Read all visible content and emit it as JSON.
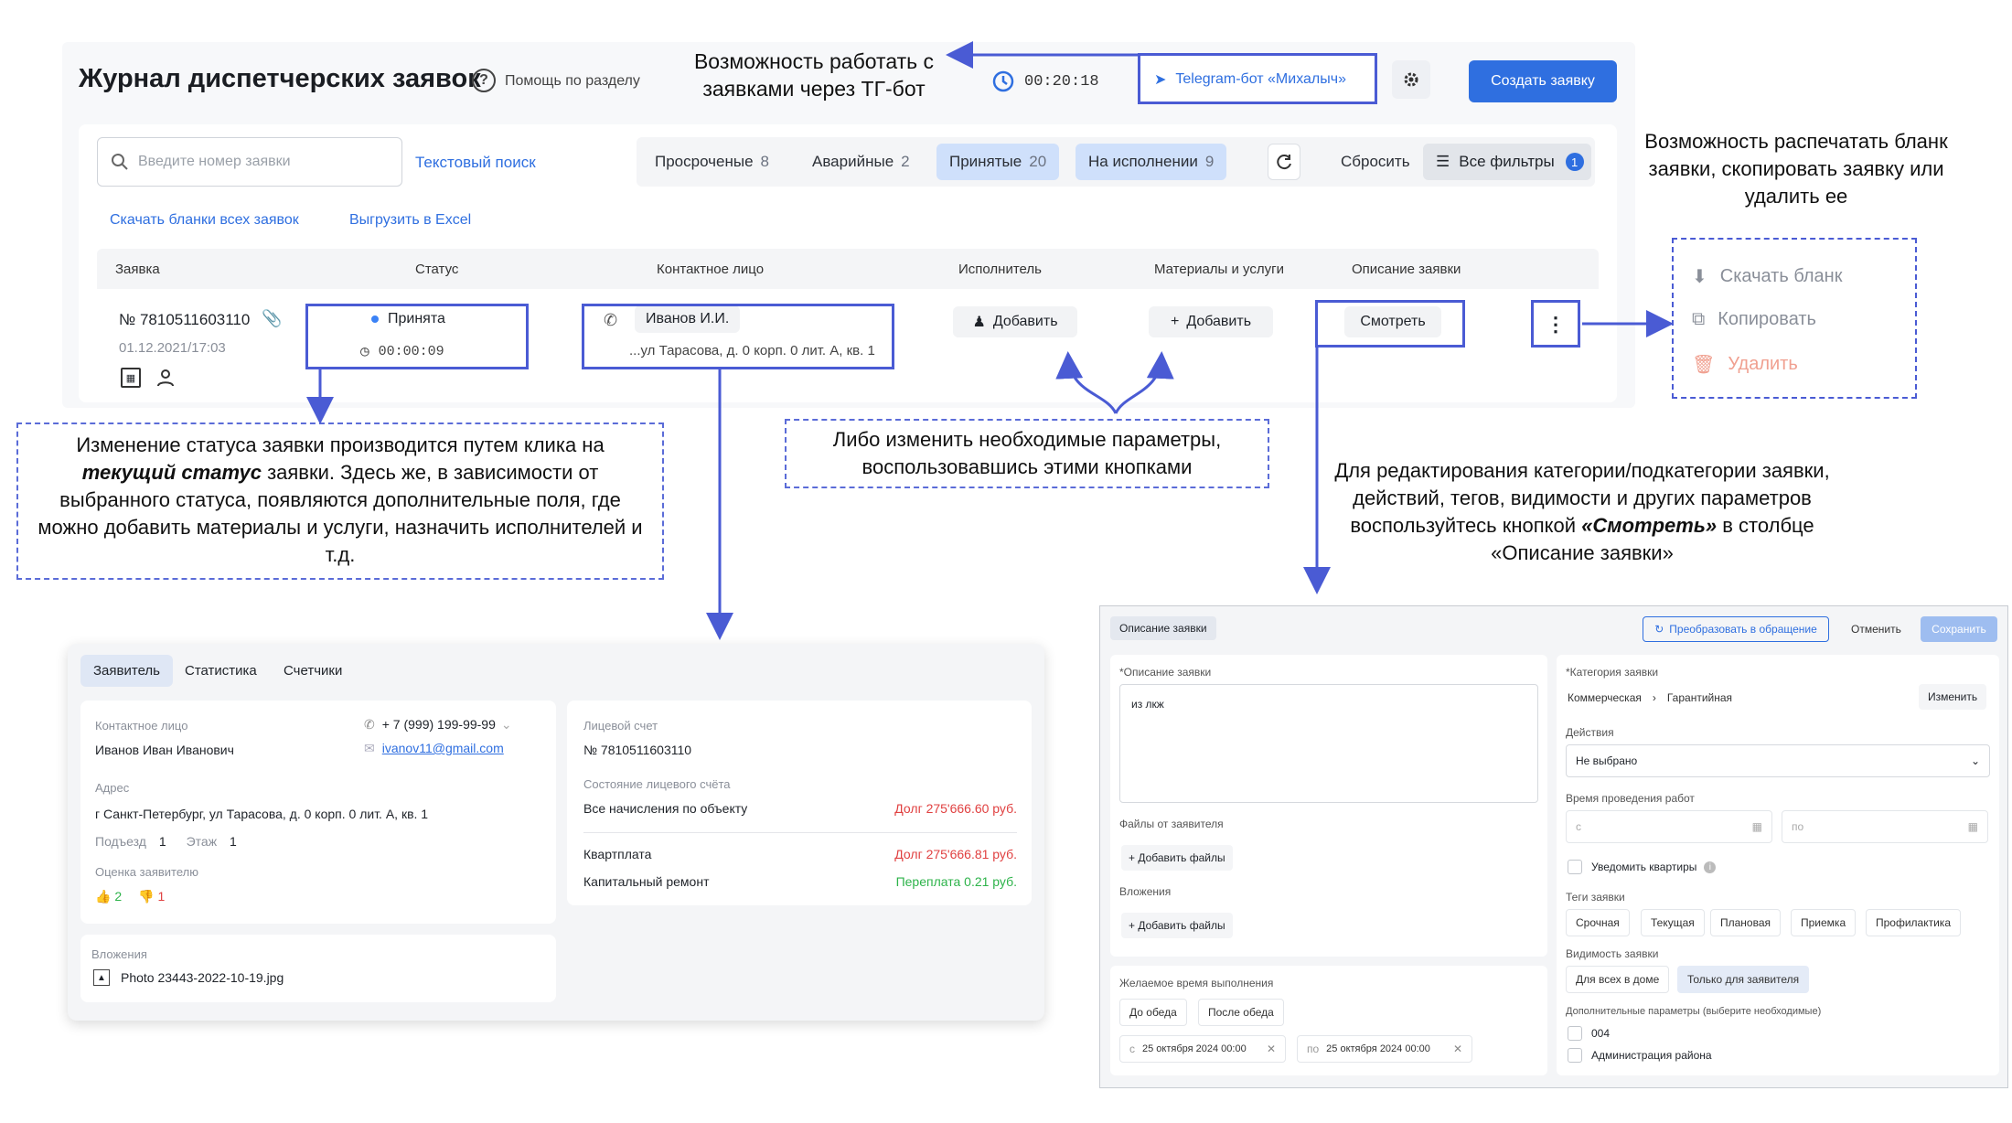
{
  "header": {
    "title": "Журнал диспетчерских заявок",
    "help": "Помощь по разделу",
    "timer": "00:20:18",
    "telegram": "Telegram-бот «Михалыч»",
    "create": "Создать заявку"
  },
  "search": {
    "placeholder": "Введите номер заявки",
    "text_search": "Текстовый поиск"
  },
  "filters": [
    {
      "label": "Просроченые",
      "count": "8"
    },
    {
      "label": "Аварийные",
      "count": "2"
    },
    {
      "label": "Принятые",
      "count": "20"
    },
    {
      "label": "На исполнении",
      "count": "9"
    }
  ],
  "reset": "Сбросить",
  "all_filters": "Все фильтры",
  "all_filters_count": "1",
  "links": {
    "download": "Скачать бланки всех заявок",
    "excel": "Выгрузить в Excel"
  },
  "table": {
    "columns": [
      "Заявка",
      "Статус",
      "Контактное лицо",
      "Исполнитель",
      "Материалы и услуги",
      "Описание заявки"
    ],
    "row": {
      "number": "№ 7810511603110",
      "date": "01.12.2021/17:03",
      "status": "Принята",
      "status_timer": "00:00:09",
      "contact": "Иванов И.И.",
      "address": "...ул Тарасова, д. 0 корп. 0 лит. А, кв. 1",
      "executor_add": "Добавить",
      "materials_add": "Добавить",
      "view": "Смотреть"
    }
  },
  "menu": {
    "download": "Скачать бланк",
    "copy": "Копировать",
    "delete": "Удалить"
  },
  "notes": {
    "tg": "Возможность работать с заявками через ТГ-бот",
    "print": "Возможность распечатать бланк заявки, скопировать заявку или удалить ее",
    "status_a": "Изменение статуса заявки производится путем клика на ",
    "status_b": "текущий статус",
    "status_c": " заявки. Здесь же, в зависимости от выбранного статуса, появляются дополнительные поля, где можно добавить материалы и услуги, назначить исполнителей и т.д.",
    "params": "Либо изменить необходимые параметры, воспользовавшись этими кнопками",
    "edit_a": "Для редактирования категории/подкатегории заявки, действий, тегов, видимости и других параметров воспользуйтесь кнопкой ",
    "edit_b": "«Смотреть»",
    "edit_c": " в столбце «Описание заявки»"
  },
  "detail": {
    "tabs": [
      "Заявитель",
      "Статистика",
      "Счетчики"
    ],
    "contact_label": "Контактное лицо",
    "contact": "Иванов Иван Иванович",
    "phone": "+ 7 (999) 199-99-99",
    "email": "ivanov11@gmail.com",
    "address_label": "Адрес",
    "address": "г Санкт-Петербург, ул Тарасова, д. 0 корп. 0 лит. А, кв. 1",
    "entrance_label": "Подъезд",
    "entrance": "1",
    "floor_label": "Этаж",
    "floor": "1",
    "rating_label": "Оценка заявителю",
    "likes": "2",
    "dislikes": "1",
    "attach_label": "Вложения",
    "attach_file": "Photo 23443-2022-10-19.jpg",
    "account_label": "Лицевой счет",
    "account": "№ 7810511603110",
    "state_label": "Состояние лицевого счёта",
    "charges": [
      {
        "name": "Все начисления по объекту",
        "value": "Долг 275'666.60 руб.",
        "color": "#e04040"
      },
      {
        "name": "Квартплата",
        "value": "Долг 275'666.81 руб.",
        "color": "#e04040"
      },
      {
        "name": "Капитальный ремонт",
        "value": "Переплата 0.21 руб.",
        "color": "#2db34a"
      }
    ]
  },
  "desc": {
    "tab": "Описание заявки",
    "convert": "Преобразовать в обращение",
    "cancel": "Отменить",
    "save": "Сохранить",
    "desc_label": "*Описание заявки",
    "desc_text": "из лкж",
    "files_label": "Файлы от заявителя",
    "add_files": "+ Добавить файлы",
    "attach_label": "Вложения",
    "add_files2": "+ Добавить файлы",
    "time_label": "Желаемое время выполнения",
    "before": "До обеда",
    "after": "После обеда",
    "from_prefix": "с",
    "from": "25 октября 2024 00:00",
    "to_prefix": "по",
    "to": "25 октября 2024 00:00",
    "cat_label": "*Категория заявки",
    "cat1": "Коммерческая",
    "cat2": "Гарантийная",
    "change": "Изменить",
    "actions_label": "Действия",
    "actions_value": "Не выбрано",
    "work_label": "Время проведения работ",
    "work_from": "с",
    "work_to": "по",
    "notify": "Уведомить квартиры",
    "tags_label": "Теги заявки",
    "tags": [
      "Срочная",
      "Текущая",
      "Плановая",
      "Приемка",
      "Профилактика"
    ],
    "vis_label": "Видимость заявки",
    "vis_all": "Для всех в доме",
    "vis_only": "Только для заявителя",
    "extra_label": "Дополнительные параметры (выберите необходимые)",
    "extra": [
      "004",
      "Администрация района"
    ]
  },
  "colors": {
    "accent": "#2f6fe0",
    "annotation": "#4a5bd4",
    "debt": "#e04040",
    "overpay": "#2db34a"
  }
}
